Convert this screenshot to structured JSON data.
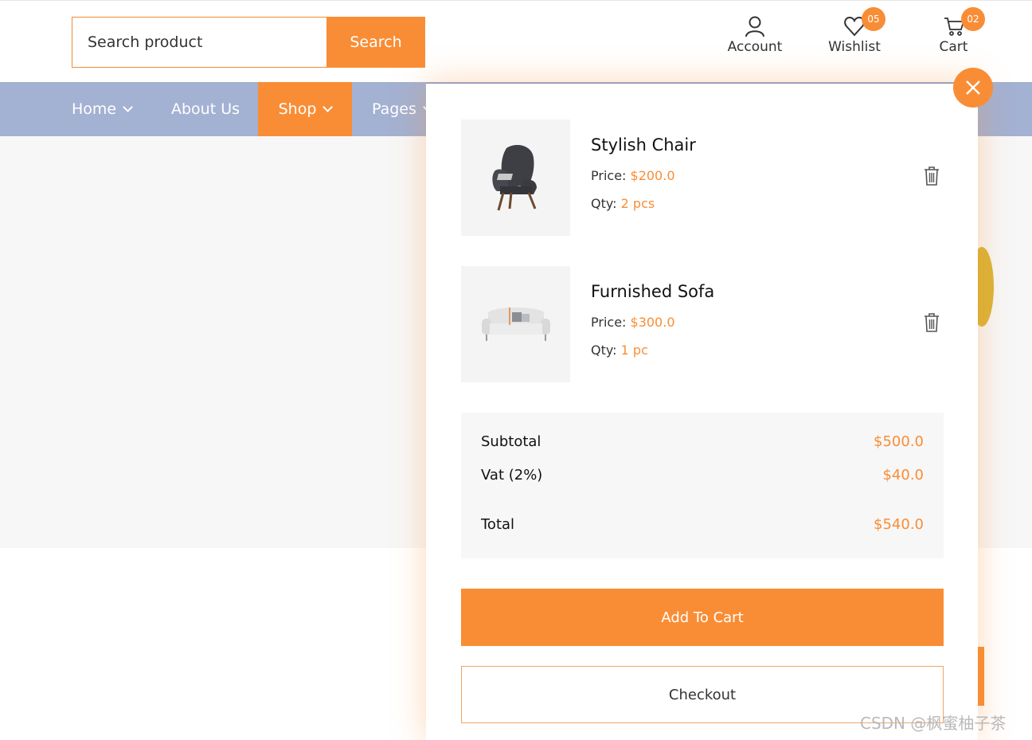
{
  "header": {
    "search": {
      "placeholder": "Search product",
      "button_label": "Search"
    },
    "account": {
      "label": "Account"
    },
    "wishlist": {
      "label": "Wishlist",
      "count": "05"
    },
    "cart": {
      "label": "Cart",
      "count": "02"
    }
  },
  "nav": {
    "items": [
      {
        "label": "Home",
        "has_dropdown": true,
        "active": false
      },
      {
        "label": "About Us",
        "has_dropdown": false,
        "active": false
      },
      {
        "label": "Shop",
        "has_dropdown": true,
        "active": true
      },
      {
        "label": "Pages",
        "has_dropdown": true,
        "active": false
      }
    ]
  },
  "cart_panel": {
    "items": [
      {
        "name": "Stylish Chair",
        "price_label": "Price:",
        "price": "$200.0",
        "qty_label": "Qty:",
        "qty": "2 pcs",
        "image_icon": "armchair-icon"
      },
      {
        "name": "Furnished Sofa",
        "price_label": "Price:",
        "price": "$300.0",
        "qty_label": "Qty:",
        "qty": "1 pc",
        "image_icon": "sofa-icon"
      }
    ],
    "totals": {
      "subtotal_label": "Subtotal",
      "subtotal": "$500.0",
      "vat_label": "Vat (2%)",
      "vat": "$40.0",
      "total_label": "Total",
      "total": "$540.0"
    },
    "add_to_cart_label": "Add To Cart",
    "checkout_label": "Checkout"
  },
  "watermark": "CSDN @枫蜜柚子茶",
  "colors": {
    "accent": "#f98d35",
    "nav_bg": "#a3b1d2",
    "hero_bg": "#f7f7f7"
  }
}
